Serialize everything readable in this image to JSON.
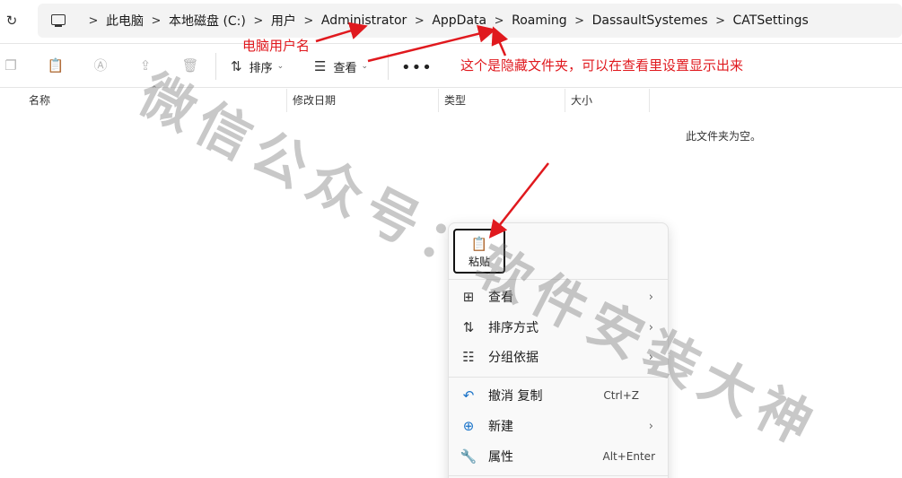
{
  "breadcrumb": [
    "此电脑",
    "本地磁盘 (C:)",
    "用户",
    "Administrator",
    "AppData",
    "Roaming",
    "DassaultSystemes",
    "CATSettings"
  ],
  "toolbar": {
    "sort_label": "排序",
    "view_label": "查看",
    "more_label": "•••"
  },
  "columns": [
    "名称",
    "修改日期",
    "类型",
    "大小"
  ],
  "empty_message": "此文件夹为空。",
  "context_menu": {
    "paste_label": "粘贴",
    "items": [
      {
        "label": "查看",
        "icon": "grid-icon",
        "has_submenu": true
      },
      {
        "label": "排序方式",
        "icon": "sort-icon",
        "has_submenu": true
      },
      {
        "label": "分组依据",
        "icon": "group-icon",
        "has_submenu": true
      },
      {
        "label": "撤消 复制",
        "icon": "undo-icon",
        "shortcut": "Ctrl+Z"
      },
      {
        "label": "新建",
        "icon": "new-icon",
        "has_submenu": true
      },
      {
        "label": "属性",
        "icon": "wrench-icon",
        "shortcut": "Alt+Enter"
      }
    ]
  },
  "annotations": {
    "user_name": "电脑用户名",
    "hidden_folder": "这个是隐藏文件夹，可以在查看里设置显示出来"
  },
  "watermark": "微信公众号：软件安装大神",
  "colors": {
    "annotation": "#e0191e",
    "paste_border": "#111111"
  }
}
